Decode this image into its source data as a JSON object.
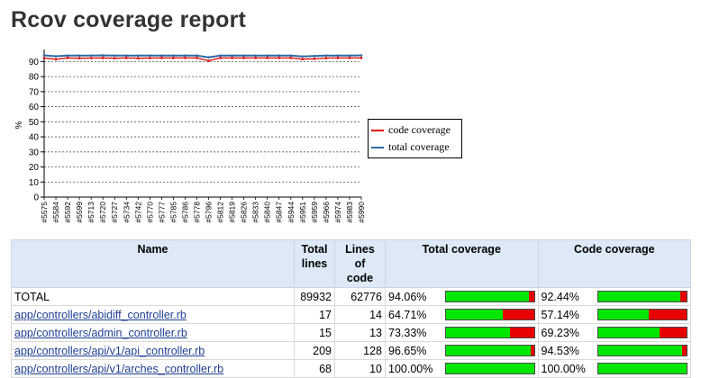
{
  "page": {
    "title": "Rcov coverage report"
  },
  "chart_data": {
    "type": "line",
    "ylabel": "%",
    "ylim": [
      0,
      95
    ],
    "yticks": [
      0,
      10,
      20,
      30,
      40,
      50,
      60,
      70,
      80,
      90
    ],
    "grid": true,
    "legend_position": "right",
    "x": [
      "#5575",
      "#5584",
      "#5592",
      "#5599",
      "#5713",
      "#5720",
      "#5727",
      "#5734",
      "#5742",
      "#5770",
      "#5777",
      "#5785",
      "#5786",
      "#5778",
      "#5796",
      "#5812",
      "#5819",
      "#5826",
      "#5833",
      "#5840",
      "#5847",
      "#5944",
      "#5951",
      "#5959",
      "#5966",
      "#5974",
      "#5983",
      "#5990"
    ],
    "series": [
      {
        "name": "code coverage",
        "color": "#e00000",
        "values": [
          92.3,
          91.5,
          92.4,
          92.2,
          92.3,
          92.4,
          92.2,
          92.4,
          92.2,
          92.3,
          92.4,
          92.4,
          92.4,
          92.4,
          90.5,
          92.4,
          92.4,
          92.4,
          92.4,
          92.4,
          92.4,
          92.4,
          91.6,
          91.8,
          92.3,
          92.4,
          92.4,
          92.4
        ]
      },
      {
        "name": "total coverage",
        "color": "#2f6aa3",
        "values": [
          94.1,
          93.5,
          94.0,
          93.9,
          94.0,
          94.1,
          94.0,
          94.0,
          93.9,
          94.0,
          94.0,
          94.0,
          94.0,
          94.0,
          92.8,
          94.0,
          94.0,
          94.0,
          94.0,
          94.0,
          94.0,
          94.0,
          93.4,
          93.6,
          94.0,
          94.0,
          94.0,
          94.1
        ]
      }
    ]
  },
  "table": {
    "headers": {
      "name": "Name",
      "total_lines_1": "Total",
      "total_lines_2": "lines",
      "loc_1": "Lines of",
      "loc_2": "code",
      "total_cov": "Total coverage",
      "code_cov": "Code coverage"
    },
    "rows": [
      {
        "name": "TOTAL",
        "link": false,
        "total_lines": "89932",
        "loc": "62776",
        "total_pct": "94.06%",
        "total_val": 94.06,
        "code_pct": "92.44%",
        "code_val": 92.44
      },
      {
        "name": "app/controllers/abidiff_controller.rb",
        "link": true,
        "total_lines": "17",
        "loc": "14",
        "total_pct": "64.71%",
        "total_val": 64.71,
        "code_pct": "57.14%",
        "code_val": 57.14
      },
      {
        "name": "app/controllers/admin_controller.rb",
        "link": true,
        "total_lines": "15",
        "loc": "13",
        "total_pct": "73.33%",
        "total_val": 73.33,
        "code_pct": "69.23%",
        "code_val": 69.23
      },
      {
        "name": "app/controllers/api/v1/api_controller.rb",
        "link": true,
        "total_lines": "209",
        "loc": "128",
        "total_pct": "96.65%",
        "total_val": 96.65,
        "code_pct": "94.53%",
        "code_val": 94.53
      },
      {
        "name": "app/controllers/api/v1/arches_controller.rb",
        "link": true,
        "total_lines": "68",
        "loc": "10",
        "total_pct": "100.00%",
        "total_val": 100,
        "code_pct": "100.00%",
        "code_val": 100
      }
    ]
  }
}
